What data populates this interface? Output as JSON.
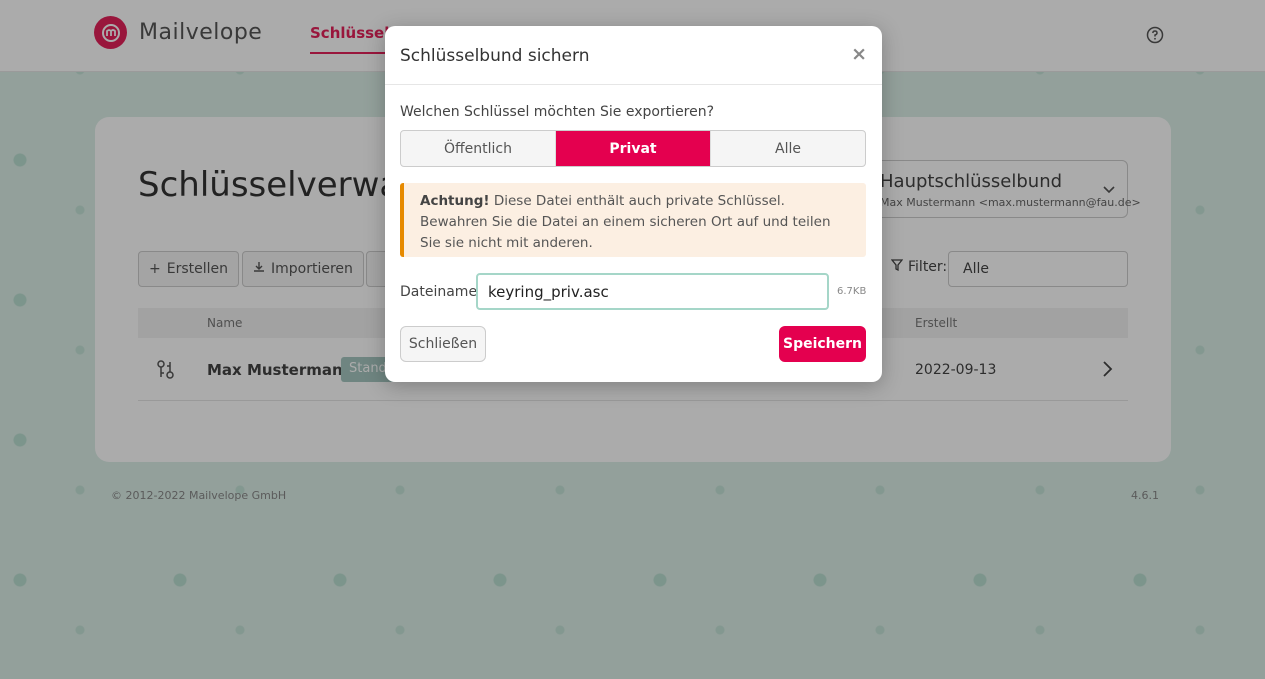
{
  "navbar": {
    "brand": "Mailvelope",
    "active_tab": "Schlüsselverwaltung"
  },
  "page": {
    "title": "Schlüsselverwaltung",
    "keyring": {
      "name": "Hauptschlüsselbund",
      "user": "Max Mustermann <max.mustermann@fau.de>"
    },
    "toolbar": {
      "create": "Erstellen",
      "import": "Importieren"
    },
    "filter": {
      "label": "Filter:",
      "value": "Alle"
    },
    "table": {
      "headers": {
        "name": "Name",
        "created": "Erstellt"
      },
      "rows": [
        {
          "name": "Max Mustermann",
          "badge": "Standard",
          "created": "2022-09-13"
        }
      ]
    }
  },
  "footer": {
    "copyright": "© 2012-2022  Mailvelope GmbH",
    "version": "4.6.1"
  },
  "modal": {
    "title": "Schlüsselbund sichern",
    "close_symbol": "×",
    "question": "Welchen Schlüssel möchten Sie exportieren?",
    "segments": [
      "Öffentlich",
      "Privat",
      "Alle"
    ],
    "active_segment": "Privat",
    "alert": {
      "strong": "Achtung!",
      "text": " Diese Datei enthält auch private Schlüssel. Bewahren Sie die Datei an einem sicheren Ort auf und teilen Sie sie nicht mit anderen."
    },
    "filename_label": "Dateiname",
    "filename_value": "keyring_priv.asc",
    "file_size": "6.7KB",
    "close_button": "Schließen",
    "save_button": "Speichern"
  },
  "colors": {
    "brand": "#e4215a",
    "primary_button": "#e4004f",
    "alert_border": "#e68a00",
    "alert_bg": "#fcefe2",
    "background": "#dcefe8"
  }
}
